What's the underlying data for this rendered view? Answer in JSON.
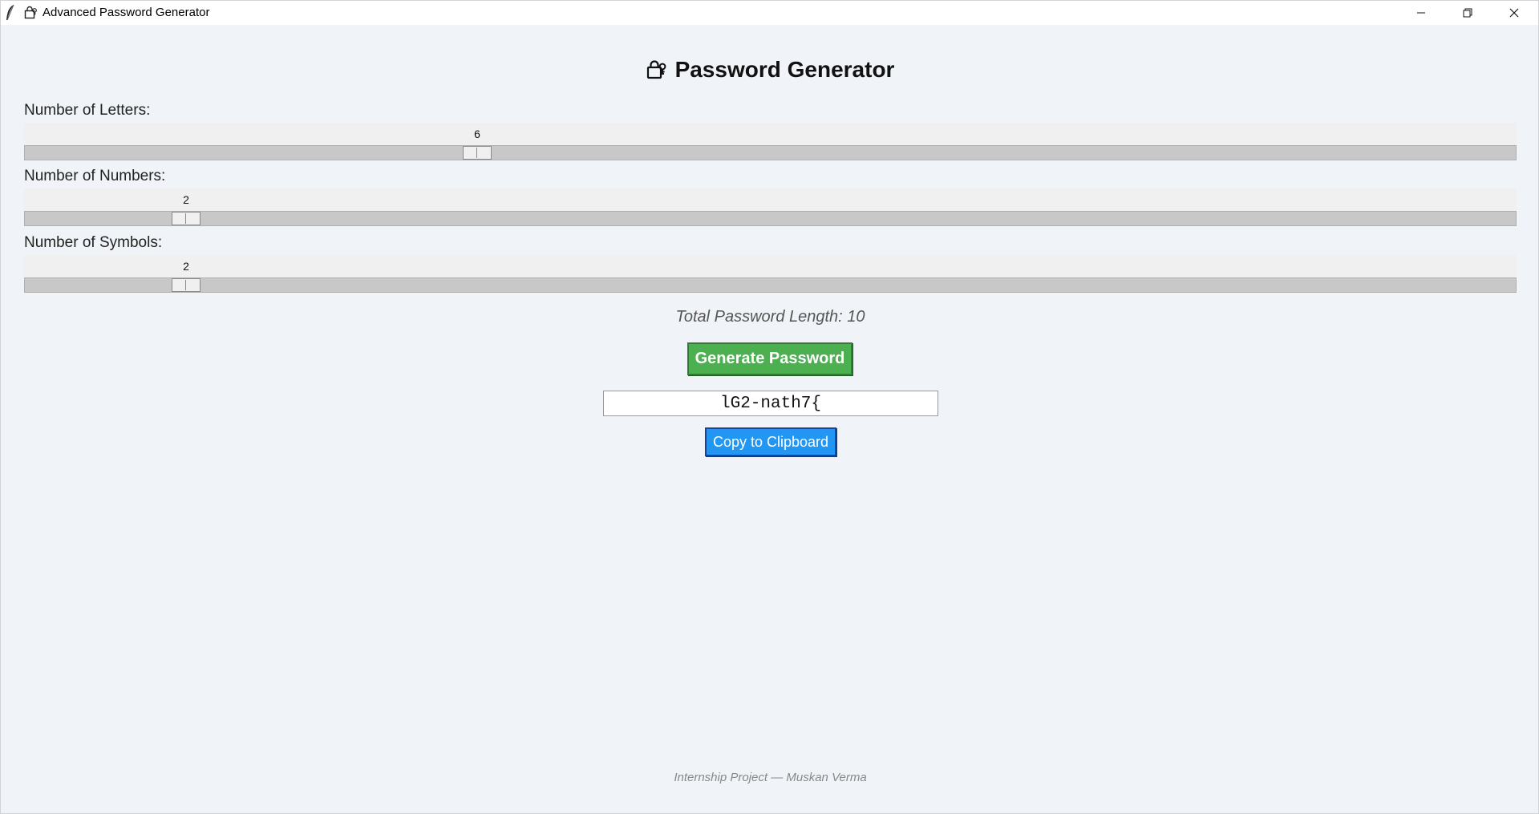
{
  "window": {
    "title": "Advanced Password Generator",
    "app_icon": "feather-icon",
    "title_icon": "lock-icon",
    "controls": [
      "minimize-icon",
      "restore-icon",
      "close-icon"
    ]
  },
  "heading": {
    "icon": "lock-icon",
    "text": "Password Generator"
  },
  "sliders": [
    {
      "label": "Number of Letters:",
      "value": "6"
    },
    {
      "label": "Number of Numbers:",
      "value": "2"
    },
    {
      "label": "Number of Symbols:",
      "value": "2"
    }
  ],
  "total_length": "Total Password Length: 10",
  "generate_button": "Generate Password",
  "password_field": {
    "value": "lG2-nath7{"
  },
  "copy_button": "Copy to Clipboard",
  "footer": "Internship Project — Muskan Verma",
  "colors": {
    "background": "#f0f4f8",
    "generate": "#4caf50",
    "copy": "#2196f3"
  }
}
